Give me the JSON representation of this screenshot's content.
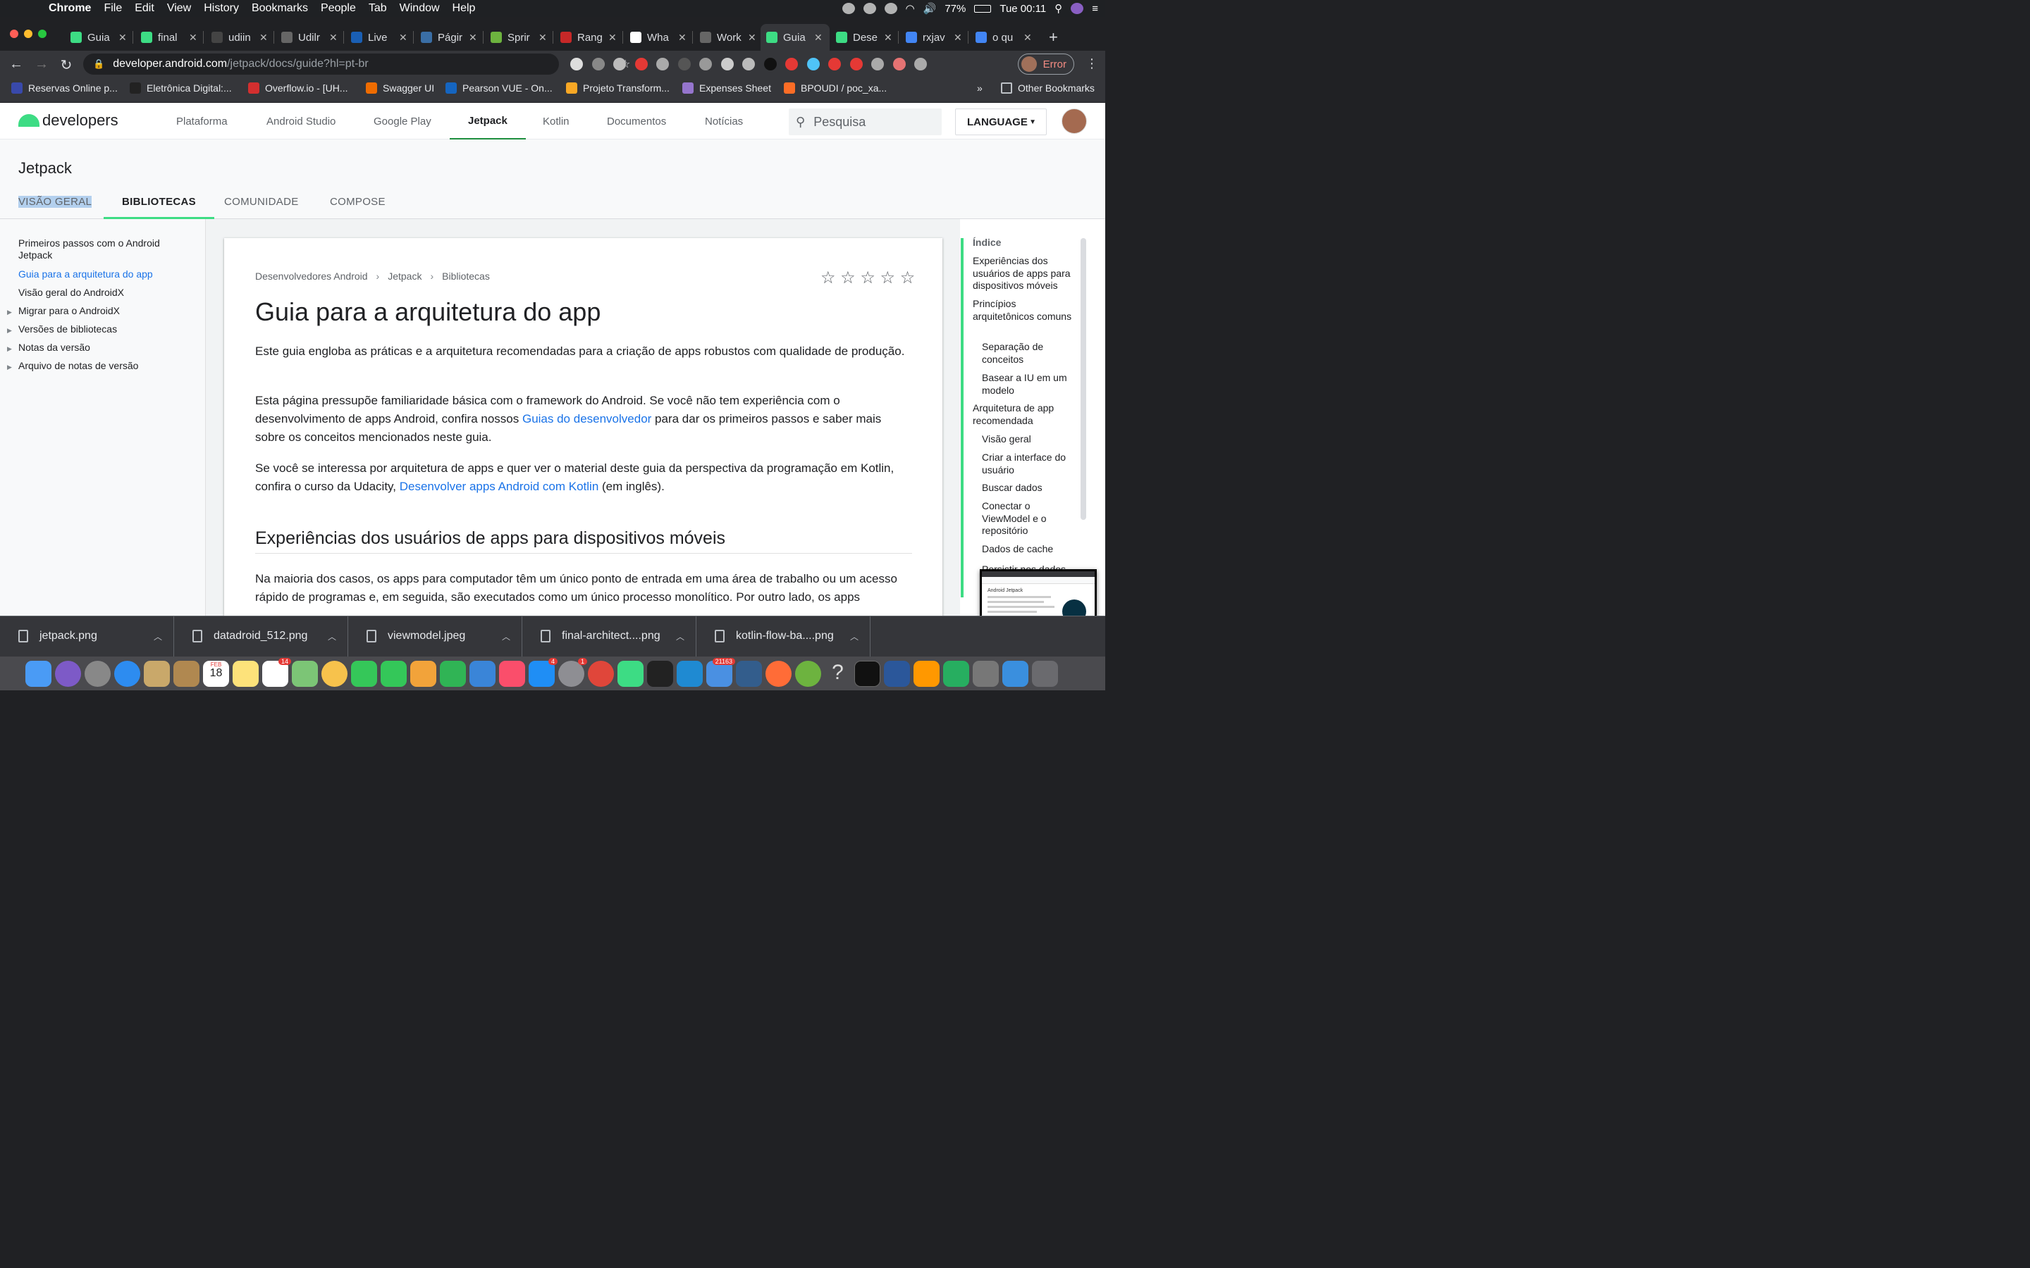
{
  "menubar": {
    "app": "Chrome",
    "items": [
      "File",
      "Edit",
      "View",
      "History",
      "Bookmarks",
      "People",
      "Tab",
      "Window",
      "Help"
    ],
    "battery": "77%",
    "clock": "Tue 00:11"
  },
  "tabs": [
    {
      "label": "Guia",
      "color": "#3ddc84"
    },
    {
      "label": "final",
      "color": "#3ddc84"
    },
    {
      "label": "udiin",
      "color": "#444444"
    },
    {
      "label": "Udilr",
      "color": "#666666"
    },
    {
      "label": "Live",
      "color": "#1a5fb4"
    },
    {
      "label": "Págir",
      "color": "#3a6ea5"
    },
    {
      "label": "Sprir",
      "color": "#6db33f"
    },
    {
      "label": "Rang",
      "color": "#c62828"
    },
    {
      "label": "Wha",
      "color": "#ffffff"
    },
    {
      "label": "Work",
      "color": "#666666"
    },
    {
      "label": "Guia",
      "color": "#3ddc84",
      "active": true
    },
    {
      "label": "Dese",
      "color": "#3ddc84"
    },
    {
      "label": "rxjav",
      "color": "#4285f4"
    },
    {
      "label": "o qu",
      "color": "#4285f4"
    }
  ],
  "address": {
    "host": "developer.android.com",
    "path": "/jetpack/docs/guide?hl=pt-br"
  },
  "profile_button": "Error",
  "bookmarks": [
    {
      "label": "Reservas Online p...",
      "color": "#3949ab"
    },
    {
      "label": "Eletrônica Digital:...",
      "color": "#222222"
    },
    {
      "label": "Overflow.io - [UH...",
      "color": "#d32f2f"
    },
    {
      "label": "Swagger UI",
      "color": "#ef6c00"
    },
    {
      "label": "Pearson VUE - On...",
      "color": "#1565c0"
    },
    {
      "label": "Projeto Transform...",
      "color": "#f9a825"
    },
    {
      "label": "Expenses Sheet",
      "color": "#9575cd"
    },
    {
      "label": "BPOUDI / poc_xa...",
      "color": "#fc6d26"
    }
  ],
  "other_bookmarks": "Other Bookmarks",
  "site": {
    "logo": "developers",
    "nav": [
      "Plataforma",
      "Android Studio",
      "Google Play",
      "Jetpack",
      "Kotlin",
      "Documentos",
      "Notícias"
    ],
    "active_nav": "Jetpack",
    "search_placeholder": "Pesquisa",
    "language": "LANGUAGE"
  },
  "section": {
    "title": "Jetpack",
    "tabs": [
      "VISÃO GERAL",
      "BIBLIOTECAS",
      "COMUNIDADE",
      "COMPOSE"
    ]
  },
  "leftnav": [
    {
      "label": "Primeiros passos com o Android Jetpack"
    },
    {
      "label": "Guia para a arquitetura do app",
      "active": true
    },
    {
      "label": "Visão geral do AndroidX"
    },
    {
      "label": "Migrar para o AndroidX",
      "expandable": true
    },
    {
      "label": "Versões de bibliotecas",
      "expandable": true
    },
    {
      "label": "Notas da versão",
      "expandable": true
    },
    {
      "label": "Arquivo de notas de versão",
      "expandable": true
    }
  ],
  "breadcrumb": [
    "Desenvolvedores Android",
    "Jetpack",
    "Bibliotecas"
  ],
  "rating_stars": "☆ ☆ ☆ ☆ ☆",
  "article": {
    "title": "Guia para a arquitetura do app",
    "p1": "Este guia engloba as práticas e a arquitetura recomendadas para a criação de apps robustos com qualidade de produção.",
    "p2_before": "Esta página pressupõe familiaridade básica com o framework do Android. Se você não tem experiência com o desenvolvimento de apps Android, confira nossos ",
    "p2_link": "Guias do desenvolvedor",
    "p2_after": " para dar os primeiros passos e saber mais sobre os conceitos mencionados neste guia.",
    "p3_before": "Se você se interessa por arquitetura de apps e quer ver o material deste guia da perspectiva da programação em Kotlin, confira o curso da Udacity, ",
    "p3_link": "Desenvolver apps Android com Kotlin",
    "p3_after": " (em inglês).",
    "h2": "Experiências dos usuários de apps para dispositivos móveis",
    "p4": "Na maioria dos casos, os apps para computador têm um único ponto de entrada em uma área de trabalho ou um acesso rápido de programas e, em seguida, são executados como um único processo monolítico. Por outro lado, os apps"
  },
  "toc": {
    "heading": "Índice",
    "items": [
      {
        "label": "Experiências dos usuários de apps para dispositivos móveis",
        "level": 1
      },
      {
        "label": "Princípios arquitetônicos comuns",
        "level": 1
      },
      {
        "label": "Separação de conceitos",
        "level": 2
      },
      {
        "label": "Basear a IU em um modelo",
        "level": 2
      },
      {
        "label": "Arquitetura de app recomendada",
        "level": 1
      },
      {
        "label": "Visão geral",
        "level": 2
      },
      {
        "label": "Criar a interface do usuário",
        "level": 2
      },
      {
        "label": "Buscar dados",
        "level": 2
      },
      {
        "label": "Conectar o ViewModel e o repositório",
        "level": 2
      },
      {
        "label": "Dados de cache",
        "level": 2
      },
      {
        "label": "Persistir nos dados",
        "level": 2
      }
    ]
  },
  "thumbnail_title": "Android Jetpack",
  "downloads": [
    "jetpack.png",
    "datadroid_512.png",
    "viewmodel.jpeg",
    "final-architect....png",
    "kotlin-flow-ba....png"
  ],
  "dock": {
    "badges": {
      "calendar_month": "FEB",
      "calendar_day": "18",
      "reminders": "14",
      "appstore": "4",
      "settings": "1",
      "mail": "21163"
    }
  }
}
